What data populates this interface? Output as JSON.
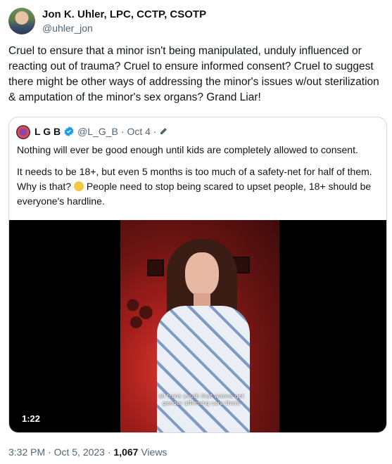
{
  "author": {
    "name": "Jon K. Uhler, LPC, CCTP, CSOTP",
    "handle": "@uhler_jon"
  },
  "tweet_text": "Cruel to ensure that a minor isn't being manipulated, unduly influenced or reacting out of trauma? Cruel to ensure informed consent? Cruel to suggest there might be other ways of addressing the minor's issues w/out sterilization & amputation of the minor's sex organs? Grand Liar!",
  "quoted": {
    "name": "L G B",
    "handle": "@L_G_B",
    "date": "· Oct 4 ·",
    "paragraph1": "Nothing will ever be good enough until kids are completely allowed to consent.",
    "paragraph2_part1": "It needs to be 18+, but even 5 months is too much of a safety-net for half of them. Why is that?",
    "paragraph2_part2": "People need to stop being scared to upset people, 18+ should be everyone's hardline.",
    "video": {
      "caption": "all trans youth that wanna get gender affirming care there",
      "duration": "1:22"
    }
  },
  "footer": {
    "time": "3:32 PM · Oct 5, 2023 ·",
    "views_count": "1,067",
    "views_label": "Views"
  },
  "colors": {
    "verified_badge": "#1d9bf0",
    "muted_text": "#536471",
    "border": "#cfd9de"
  },
  "icons": {
    "verified": "verified-badge-icon",
    "edited": "pencil-icon",
    "emoji": "thinking-face-icon"
  }
}
